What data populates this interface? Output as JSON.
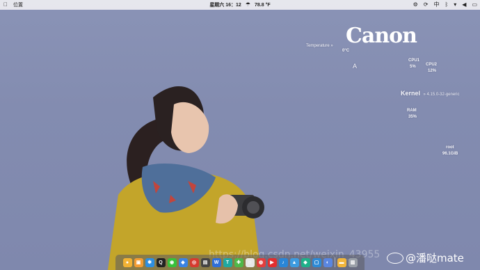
{
  "menubar": {
    "left": {
      "apple_icon": "apple-icon",
      "app_label": "位置"
    },
    "center": {
      "clock": "星期六 16：12",
      "weather_temp": "78.8 °F",
      "weather_icon": "cloud-rain-icon"
    },
    "right": {
      "items": [
        {
          "name": "settings-icon",
          "glyph": "⚙"
        },
        {
          "name": "sync-icon",
          "glyph": "⟳"
        },
        {
          "name": "input-method",
          "glyph": "中"
        },
        {
          "name": "bluetooth-icon",
          "glyph": "ᛒ"
        },
        {
          "name": "wifi-icon",
          "glyph": "▾"
        },
        {
          "name": "volume-icon",
          "glyph": "◀"
        },
        {
          "name": "battery-icon",
          "glyph": "▭"
        }
      ]
    }
  },
  "conky": {
    "temperature_label": "Temperature »",
    "temperature_value": "0°C",
    "brand": "Canon",
    "letter": "A",
    "cpu1_label": "CPU1",
    "cpu1_value": "5%",
    "cpu2_label": "CPU2",
    "cpu2_value": "12%",
    "kernel_label": "Kernel",
    "kernel_version": "» 4.15.0-32-generic",
    "ram_label": "RAM",
    "ram_value": "35%",
    "root_label": "root",
    "root_value": "96.1GiB"
  },
  "dock": {
    "apps": [
      {
        "name": "chrome-icon",
        "glyph": "●",
        "color": "#f2b233"
      },
      {
        "name": "files-icon",
        "glyph": "▣",
        "color": "#f39c32"
      },
      {
        "name": "store-icon",
        "glyph": "✱",
        "color": "#2d8ee0"
      },
      {
        "name": "qq-icon",
        "glyph": "Q",
        "color": "#222222"
      },
      {
        "name": "wechat-icon",
        "glyph": "◉",
        "color": "#36c13a"
      },
      {
        "name": "baidu-icon",
        "glyph": "◆",
        "color": "#3a83e4"
      },
      {
        "name": "netease-icon",
        "glyph": "◎",
        "color": "#d63b2f"
      },
      {
        "name": "terminal-icon",
        "glyph": "▤",
        "color": "#444444"
      },
      {
        "name": "wps-writer-icon",
        "glyph": "W",
        "color": "#2f6fd8"
      },
      {
        "name": "app-t-icon",
        "glyph": "T",
        "color": "#20a8a0"
      },
      {
        "name": "map-icon",
        "glyph": "✚",
        "color": "#4fb849"
      },
      {
        "name": "game-icon",
        "glyph": "☺",
        "color": "#e8e8e8"
      },
      {
        "name": "weibo-icon",
        "glyph": "◍",
        "color": "#e23d3d"
      },
      {
        "name": "video-icon",
        "glyph": "▶",
        "color": "#e22e2e"
      },
      {
        "name": "music-icon",
        "glyph": "♪",
        "color": "#2a86d8"
      },
      {
        "name": "photo-icon",
        "glyph": "▲",
        "color": "#3d9be0"
      },
      {
        "name": "vpn-icon",
        "glyph": "◆",
        "color": "#1fb08a"
      },
      {
        "name": "screen-icon",
        "glyph": "▢",
        "color": "#2d8ad6"
      },
      {
        "name": "settings-dock-icon",
        "glyph": "◐",
        "color": "#5a86e0"
      },
      {
        "name": "folder-icon",
        "glyph": "▬",
        "color": "#f1b53b"
      },
      {
        "name": "trash-icon",
        "glyph": "▥",
        "color": "#9aa0a8"
      }
    ]
  },
  "watermark": "https://blog.csdn.net/weixin_43955",
  "weibo": {
    "handle": "@潘哒mate"
  }
}
